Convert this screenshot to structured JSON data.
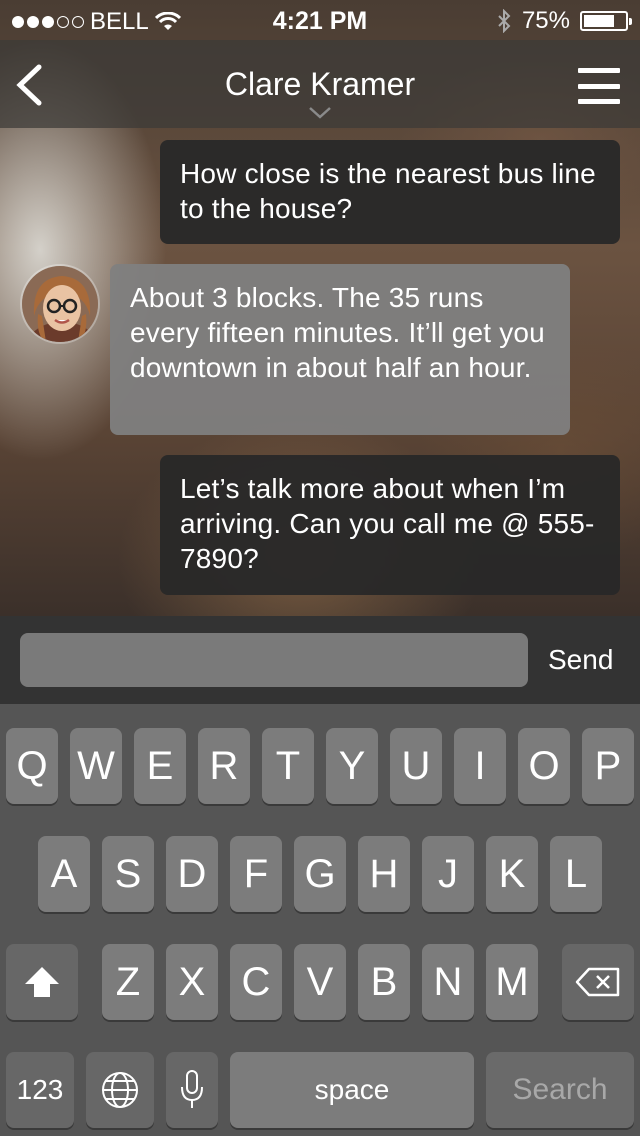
{
  "status": {
    "carrier": "BELL",
    "time": "4:21 PM",
    "battery": "75%",
    "battery_level": 0.75,
    "signal_bars_filled": 3,
    "signal_bars_total": 5
  },
  "nav": {
    "title": "Clare Kramer",
    "back_icon": "chevron-left-icon",
    "menu_icon": "hamburger-menu-icon",
    "title_dropdown_icon": "chevron-down-icon"
  },
  "messages": [
    {
      "direction": "out",
      "text": "How close is the nearest bus line to the house?"
    },
    {
      "direction": "in",
      "text": "About 3 blocks. The 35 runs every fifteen minutes. It’ll get you downtown in about half an hour."
    },
    {
      "direction": "out",
      "text": "Let’s talk more about when I’m arriving. Can you call me @ 555-7890?"
    }
  ],
  "composer": {
    "input_value": "",
    "input_placeholder": "",
    "send_label": "Send"
  },
  "keyboard": {
    "row1": [
      "Q",
      "W",
      "E",
      "R",
      "T",
      "Y",
      "U",
      "I",
      "O",
      "P"
    ],
    "row2": [
      "A",
      "S",
      "D",
      "F",
      "G",
      "H",
      "J",
      "K",
      "L"
    ],
    "row3": [
      "Z",
      "X",
      "C",
      "V",
      "B",
      "N",
      "M"
    ],
    "numbers_label": "123",
    "space_label": "space",
    "search_label": "Search"
  },
  "colors": {
    "outgoing_bubble": "#282828",
    "incoming_bubble": "#808080",
    "keyboard_bg": "#555555",
    "key": "#7c7c7c"
  }
}
